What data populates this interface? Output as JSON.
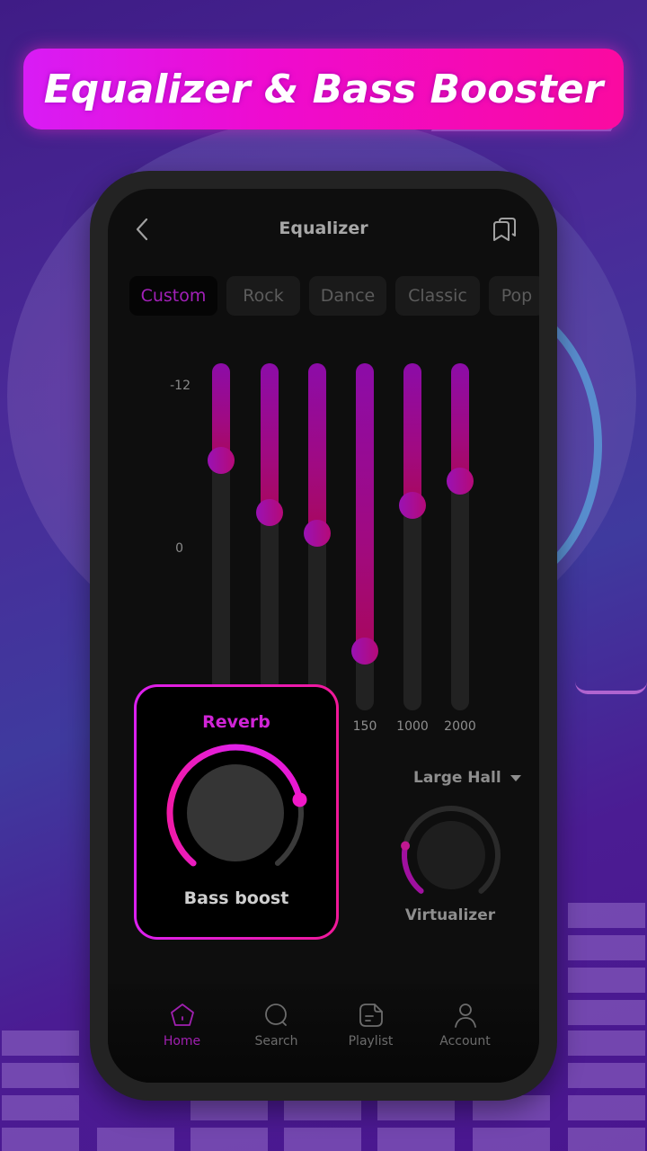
{
  "banner": {
    "title": "Equalizer & Bass Booster"
  },
  "header": {
    "title": "Equalizer",
    "back_icon": "chevron-left-icon",
    "action_icon": "presets-save-icon"
  },
  "presets": [
    {
      "label": "Custom",
      "active": true
    },
    {
      "label": "Rock",
      "active": false
    },
    {
      "label": "Dance",
      "active": false
    },
    {
      "label": "Classic",
      "active": false
    },
    {
      "label": "Pop",
      "active": false
    }
  ],
  "scale": {
    "top": "-12",
    "middle": "0"
  },
  "bands": [
    {
      "label": "",
      "level": 0.28
    },
    {
      "label": "",
      "level": 0.43
    },
    {
      "label": "",
      "level": 0.49
    },
    {
      "label": "150",
      "level": 0.83
    },
    {
      "label": "1000",
      "level": 0.41
    },
    {
      "label": "2000",
      "level": 0.34
    }
  ],
  "reverb_card": {
    "title": "Reverb",
    "knob_label": "Bass boost",
    "value": 0.78
  },
  "virtualizer": {
    "preset": "Large Hall",
    "label": "Virtualizer",
    "value": 0.22
  },
  "colors": {
    "accent": "#d024d6",
    "accent_dark": "#a020b0",
    "pink": "#f01898"
  },
  "bottom_nav": [
    {
      "label": "Home",
      "icon": "home-icon",
      "active": true
    },
    {
      "label": "Search",
      "icon": "search-icon",
      "active": false
    },
    {
      "label": "Playlist",
      "icon": "playlist-icon",
      "active": false
    },
    {
      "label": "Account",
      "icon": "account-icon",
      "active": false
    }
  ]
}
